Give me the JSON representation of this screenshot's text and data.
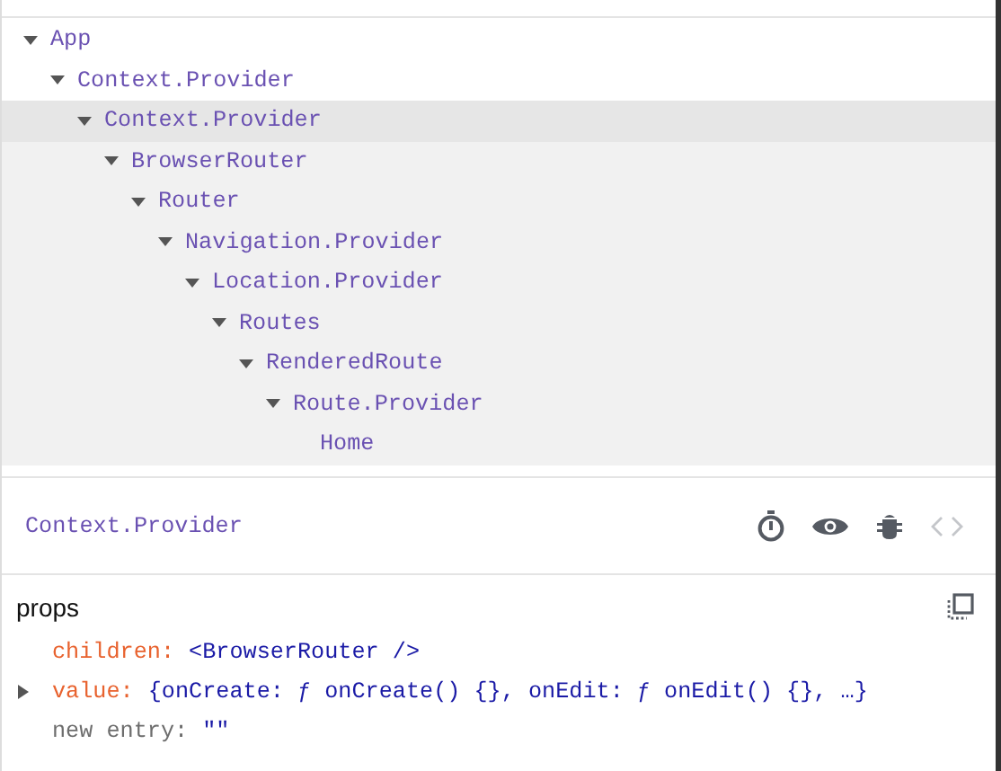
{
  "tree": [
    {
      "name": "App",
      "expanded": true,
      "selected": false,
      "children": [
        {
          "name": "Context.Provider",
          "expanded": true,
          "selected": false,
          "children": [
            {
              "name": "Context.Provider",
              "expanded": true,
              "selected": true,
              "children": [
                {
                  "name": "BrowserRouter",
                  "expanded": true,
                  "selected": false,
                  "children": [
                    {
                      "name": "Router",
                      "expanded": true,
                      "selected": false,
                      "children": [
                        {
                          "name": "Navigation.Provider",
                          "expanded": true,
                          "selected": false,
                          "children": [
                            {
                              "name": "Location.Provider",
                              "expanded": true,
                              "selected": false,
                              "children": [
                                {
                                  "name": "Routes",
                                  "expanded": true,
                                  "selected": false,
                                  "children": [
                                    {
                                      "name": "RenderedRoute",
                                      "expanded": true,
                                      "selected": false,
                                      "children": [
                                        {
                                          "name": "Route.Provider",
                                          "expanded": true,
                                          "selected": false,
                                          "children": [
                                            {
                                              "name": "Home",
                                              "expanded": false,
                                              "selected": false
                                            }
                                          ]
                                        }
                                      ]
                                    }
                                  ]
                                }
                              ]
                            }
                          ]
                        }
                      ]
                    }
                  ]
                }
              ]
            }
          ]
        }
      ]
    }
  ],
  "inspector": {
    "component_name": "Context.Provider"
  },
  "props": {
    "title": "props",
    "entries": [
      {
        "kind": "prop",
        "key": "children:",
        "value": "<BrowserRouter />"
      },
      {
        "kind": "prop",
        "key": "value:",
        "value": "{onCreate: ƒ onCreate() {}, onEdit: ƒ onEdit() {}, …}",
        "expanded": false
      },
      {
        "kind": "new",
        "key": "new entry:",
        "value": "\"\""
      }
    ]
  }
}
